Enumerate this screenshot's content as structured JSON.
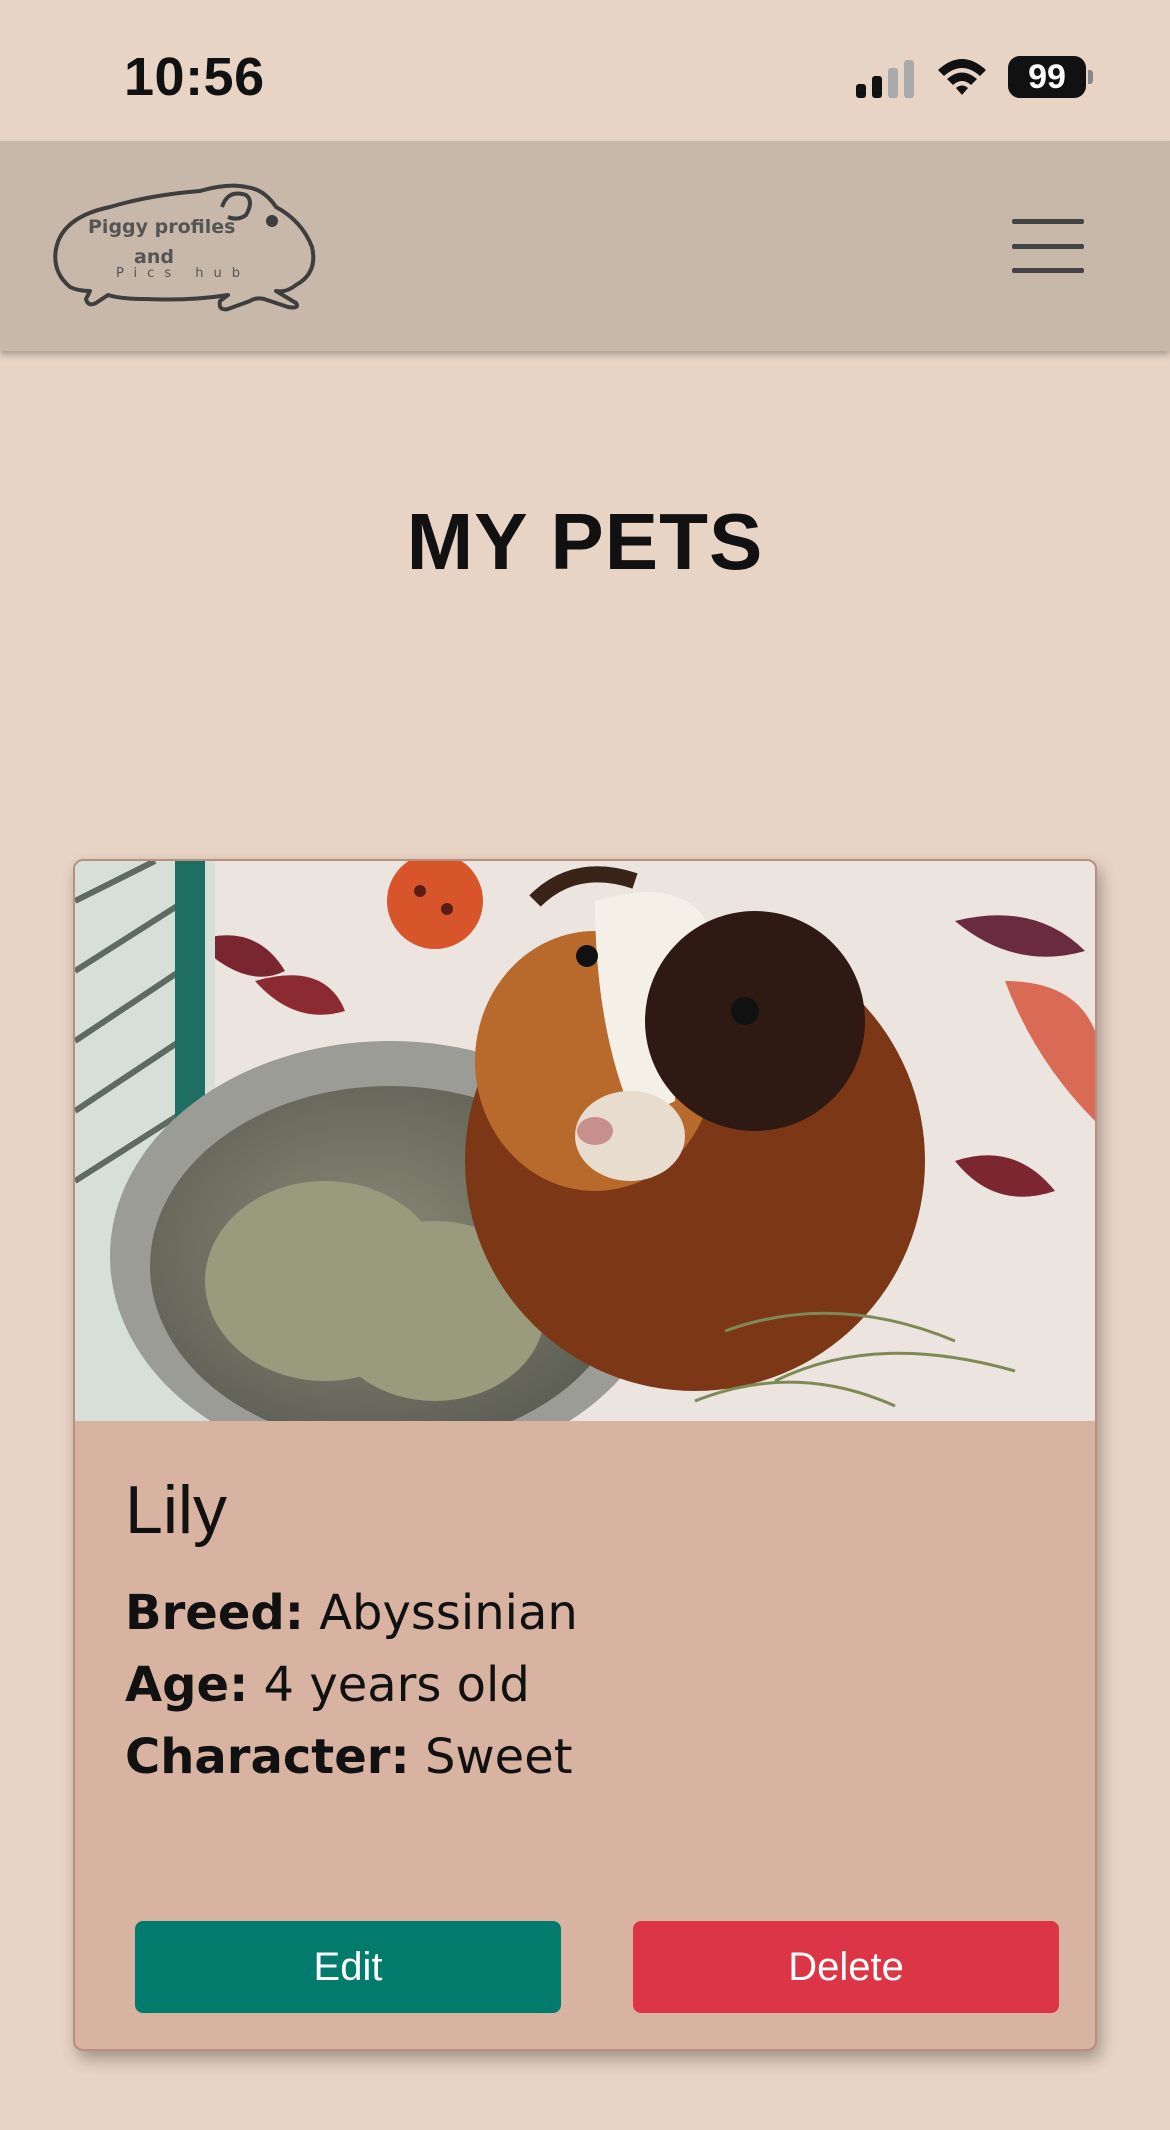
{
  "status_bar": {
    "time": "10:56",
    "battery": "99",
    "icons": [
      "signal-icon",
      "wifi-icon",
      "battery-icon"
    ]
  },
  "navbar": {
    "logo": {
      "line1": "Piggy profiles",
      "line2": "and",
      "line3": "Pics hub"
    },
    "menu_icon": "hamburger-menu-icon"
  },
  "page": {
    "title": "MY PETS"
  },
  "pets": [
    {
      "name": "Lily",
      "breed_label": "Breed:",
      "breed": "Abyssinian",
      "age_label": "Age:",
      "age": "4 years old",
      "character_label": "Character:",
      "character": "Sweet",
      "edit_label": "Edit",
      "delete_label": "Delete"
    }
  ],
  "colors": {
    "background": "#e8d4c5",
    "navbar": "#c8b8aa",
    "card": "#d8b3a1",
    "edit_button": "#027a6c",
    "delete_button": "#dc3545"
  }
}
